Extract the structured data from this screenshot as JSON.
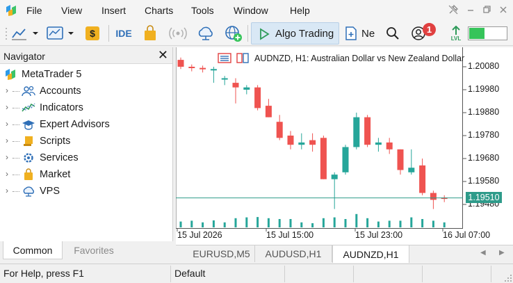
{
  "menu": [
    "File",
    "View",
    "Insert",
    "Charts",
    "Tools",
    "Window",
    "Help"
  ],
  "toolbar": {
    "ide_label": "IDE",
    "algo_trading_label": "Algo Trading",
    "new_order_label": "Ne",
    "notification_count": "1",
    "level_label": "LVL",
    "level_fill": 0.42,
    "accent": "#36c45a"
  },
  "navigator": {
    "title": "Navigator",
    "close_label": "✕",
    "root": "MetaTrader 5",
    "items": [
      "Accounts",
      "Indicators",
      "Expert Advisors",
      "Scripts",
      "Services",
      "Market",
      "VPS"
    ],
    "tabs": [
      "Common",
      "Favorites"
    ]
  },
  "chart": {
    "info": "AUDNZD, H1:  Australian Dollar vs New Zealand Dollar",
    "current_price": "1.19510",
    "bull_color": "#26a69a",
    "bear_color": "#ef5350"
  },
  "chart_tabs": [
    "EURUSD,M5",
    "AUDUSD,H1",
    "AUDNZD,H1"
  ],
  "chart_data": {
    "type": "candlestick",
    "symbol": "AUDNZD",
    "timeframe": "H1",
    "y_ticks": [
      "1.20080",
      "1.19980",
      "1.19880",
      "1.19780",
      "1.19680",
      "1.19580",
      "1.19480"
    ],
    "y_range": [
      1.1942,
      1.2016
    ],
    "x_ticks": [
      "15 Jul 2026",
      "15 Jul 15:00",
      "15 Jul 23:00",
      "16 Jul 07:00"
    ],
    "current_price": 1.1951,
    "candles": [
      {
        "o": 1.2011,
        "h": 1.2012,
        "l": 1.2007,
        "c": 1.2008
      },
      {
        "o": 1.2008,
        "h": 1.2009,
        "l": 1.2006,
        "c": 1.20075
      },
      {
        "o": 1.20075,
        "h": 1.20085,
        "l": 1.20055,
        "c": 1.2007
      },
      {
        "o": 1.2007,
        "h": 1.2008,
        "l": 1.2001,
        "c": 1.2007
      },
      {
        "o": 1.2003,
        "h": 1.2004,
        "l": 1.2,
        "c": 1.2003
      },
      {
        "o": 1.2001,
        "h": 1.2003,
        "l": 1.1992,
        "c": 1.1999
      },
      {
        "o": 1.1998,
        "h": 1.2,
        "l": 1.1996,
        "c": 1.1999
      },
      {
        "o": 1.1999,
        "h": 1.2,
        "l": 1.1989,
        "c": 1.199
      },
      {
        "o": 1.1991,
        "h": 1.1994,
        "l": 1.1986,
        "c": 1.1986
      },
      {
        "o": 1.1984,
        "h": 1.1987,
        "l": 1.1976,
        "c": 1.1977
      },
      {
        "o": 1.1978,
        "h": 1.198,
        "l": 1.1972,
        "c": 1.1974
      },
      {
        "o": 1.1974,
        "h": 1.1979,
        "l": 1.1972,
        "c": 1.1975
      },
      {
        "o": 1.1976,
        "h": 1.1979,
        "l": 1.1971,
        "c": 1.1974
      },
      {
        "o": 1.1977,
        "h": 1.1978,
        "l": 1.1959,
        "c": 1.1959
      },
      {
        "o": 1.1959,
        "h": 1.1962,
        "l": 1.1946,
        "c": 1.1961
      },
      {
        "o": 1.1962,
        "h": 1.1974,
        "l": 1.1961,
        "c": 1.1973
      },
      {
        "o": 1.1973,
        "h": 1.1988,
        "l": 1.1972,
        "c": 1.1986
      },
      {
        "o": 1.1986,
        "h": 1.1987,
        "l": 1.1973,
        "c": 1.1974
      },
      {
        "o": 1.1974,
        "h": 1.1977,
        "l": 1.1971,
        "c": 1.1975
      },
      {
        "o": 1.1975,
        "h": 1.1977,
        "l": 1.197,
        "c": 1.1972
      },
      {
        "o": 1.1972,
        "h": 1.1972,
        "l": 1.1961,
        "c": 1.1963
      },
      {
        "o": 1.1962,
        "h": 1.1972,
        "l": 1.1961,
        "c": 1.1964
      },
      {
        "o": 1.1965,
        "h": 1.1968,
        "l": 1.1952,
        "c": 1.1953
      },
      {
        "o": 1.1953,
        "h": 1.1954,
        "l": 1.1946,
        "c": 1.195
      },
      {
        "o": 1.1951,
        "h": 1.1952,
        "l": 1.1949,
        "c": 1.19505
      }
    ],
    "volumes": [
      0.35,
      0.4,
      0.3,
      0.42,
      0.3,
      0.55,
      0.6,
      0.62,
      0.55,
      0.5,
      0.5,
      0.3,
      0.25,
      0.55,
      0.6,
      0.5,
      0.8,
      0.55,
      0.35,
      0.4,
      0.4,
      0.6,
      0.5,
      0.4,
      0.3
    ]
  }
}
